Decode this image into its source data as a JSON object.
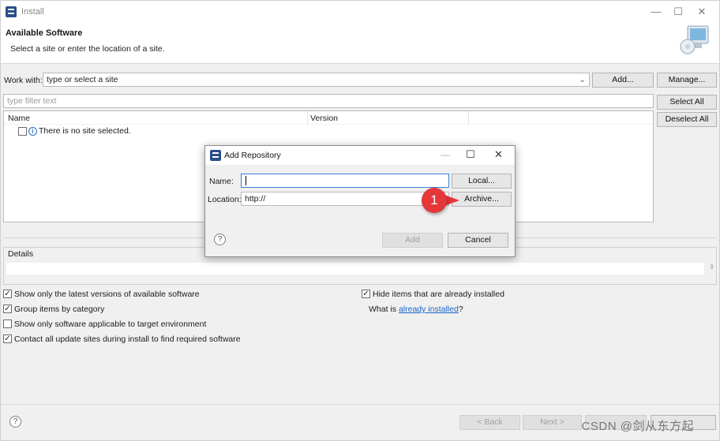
{
  "window": {
    "title": "Install",
    "banner_title": "Available Software",
    "banner_subtitle": "Select a site or enter the location of a site."
  },
  "work_with": {
    "label": "Work with:",
    "value": "type or select a site",
    "add_label": "Add...",
    "manage_label": "Manage..."
  },
  "filter": {
    "placeholder": "type filter text"
  },
  "side_buttons": {
    "select_all": "Select All",
    "deselect_all": "Deselect All"
  },
  "tree": {
    "columns": [
      "Name",
      "Version"
    ],
    "message": "There is no site selected."
  },
  "details": {
    "label": "Details"
  },
  "options": {
    "latest_versions": "Show only the latest versions of available software",
    "group_by_category": "Group items by category",
    "target_env": "Show only software applicable to target environment",
    "contact_sites": "Contact all update sites during install to find required software",
    "hide_installed": "Hide items that are already installed",
    "what_is_prefix": "What is ",
    "what_is_link": "already installed",
    "what_is_suffix": "?"
  },
  "footer": {
    "back": "< Back",
    "next": "Next >"
  },
  "dialog": {
    "title": "Add Repository",
    "name_label": "Name:",
    "name_value": "",
    "location_label": "Location:",
    "location_value": "http://",
    "local_label": "Local...",
    "archive_label": "Archive...",
    "add_label": "Add",
    "cancel_label": "Cancel"
  },
  "annotation": {
    "marker": "1"
  },
  "watermark": "CSDN @剑从东方起",
  "colors": {
    "marker": "#e5363a",
    "link": "#1a66c9"
  }
}
